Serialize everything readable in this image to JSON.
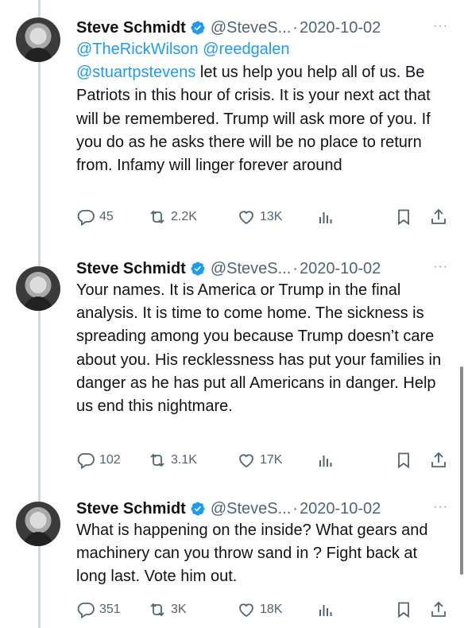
{
  "tweets": [
    {
      "name": "Steve Schmidt",
      "handle": "@SteveS...",
      "dot": "·",
      "date": "2020-10-02",
      "more": "···",
      "mention1": "@TheRickWilson",
      "mention2": "@reedgalen",
      "mention3": "@stuartpstevens",
      "body": " let us help you help all of us. Be Patriots in this hour of crisis. It is your next act that will be remembered. Trump will ask more of you. If you do as he asks there will be no place to return from. Infamy will linger forever around",
      "replies": "45",
      "retweets": "2.2K",
      "likes": "13K"
    },
    {
      "name": "Steve Schmidt",
      "handle": "@SteveS...",
      "dot": "·",
      "date": "2020-10-02",
      "more": "···",
      "body": "Your names. It is America or Trump in the final analysis. It is time to come home. The sickness is spreading among  you because Trump doesn’t care about you. His recklessness has put your families in danger as he has put all Americans in danger. Help us end this nightmare.",
      "replies": "102",
      "retweets": "3.1K",
      "likes": "17K"
    },
    {
      "name": "Steve Schmidt",
      "handle": "@SteveS...",
      "dot": "·",
      "date": "2020-10-02",
      "more": "···",
      "body": "What is happening on the inside? What gears and machinery can you throw sand in ?  Fight back at long last. Vote him out.",
      "replies": "351",
      "retweets": "3K",
      "likes": "18K"
    }
  ],
  "icons": {
    "verified": "verified-badge-icon",
    "reply": "reply-icon",
    "retweet": "retweet-icon",
    "like": "heart-icon",
    "views": "views-icon",
    "bookmark": "bookmark-icon",
    "share": "share-icon"
  },
  "colors": {
    "mention": "#1d9bf0",
    "secondary_text": "#536471",
    "thread_line": "#cfd9de"
  }
}
